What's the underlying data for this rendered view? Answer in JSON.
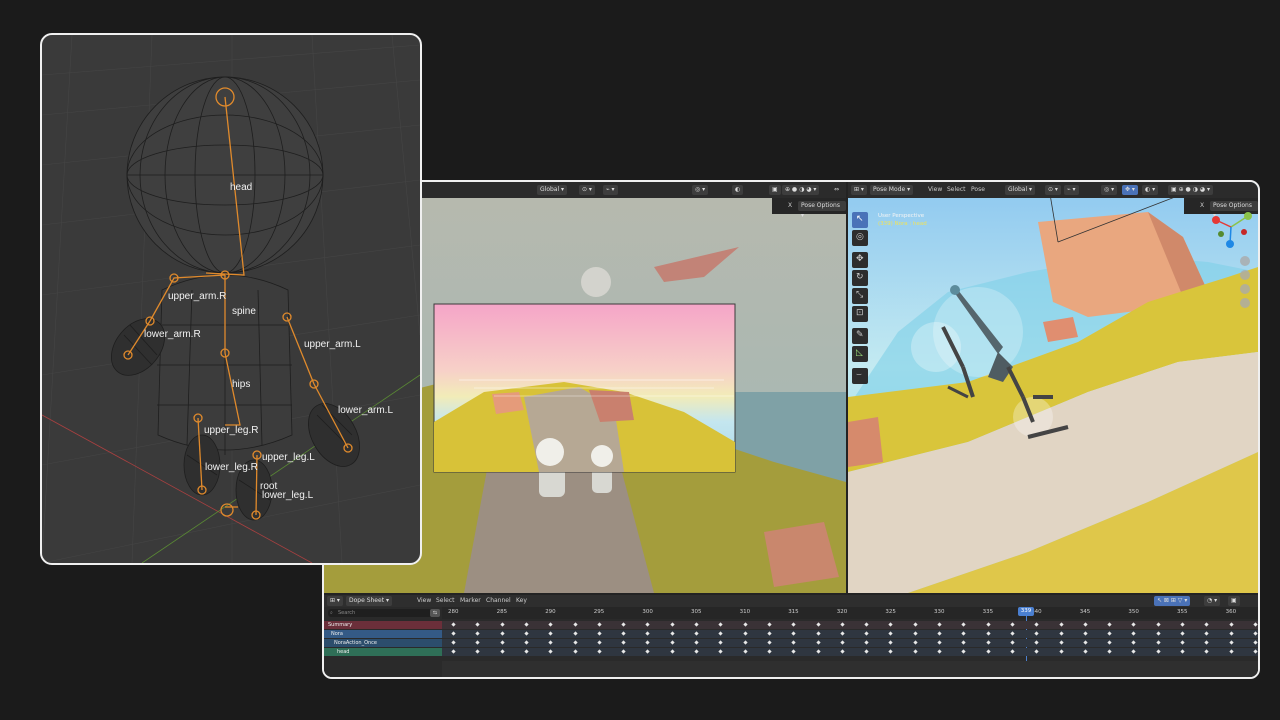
{
  "left_viewport": {
    "header": {
      "transform_orientation": "Global",
      "pose_options": "Pose Options",
      "close": "X"
    }
  },
  "right_viewport": {
    "header": {
      "mode": "Pose Mode",
      "menu": [
        "View",
        "Select",
        "Pose"
      ],
      "transform_orientation": "Global",
      "pose_options": "Pose Options",
      "close": "X"
    },
    "overlay": {
      "perspective": "User Perspective",
      "object": "(339) Nora : head"
    }
  },
  "dope_sheet": {
    "editor_type": "Dope Sheet",
    "menu": [
      "View",
      "Select",
      "Marker",
      "Channel",
      "Key"
    ],
    "search_placeholder": "Search",
    "current_frame": "339",
    "ticks": [
      "280",
      "285",
      "290",
      "295",
      "300",
      "305",
      "310",
      "315",
      "320",
      "325",
      "330",
      "335",
      "340",
      "345",
      "350",
      "355",
      "360"
    ],
    "channels": [
      {
        "label": "Summary",
        "color": "#6b2f3a"
      },
      {
        "label": "Nora",
        "color": "#345a86"
      },
      {
        "label": "NoraAction_Once",
        "color": "#2c4d6c"
      },
      {
        "label": "head",
        "color": "#2f6f57"
      }
    ]
  },
  "rig": {
    "bones": [
      "head",
      "upper_arm.R",
      "spine",
      "lower_arm.R",
      "upper_arm.L",
      "hips",
      "lower_arm.L",
      "upper_leg.R",
      "upper_leg.L",
      "lower_leg.R",
      "root",
      "lower_leg.L"
    ],
    "bone_color": "#e08a2c"
  }
}
